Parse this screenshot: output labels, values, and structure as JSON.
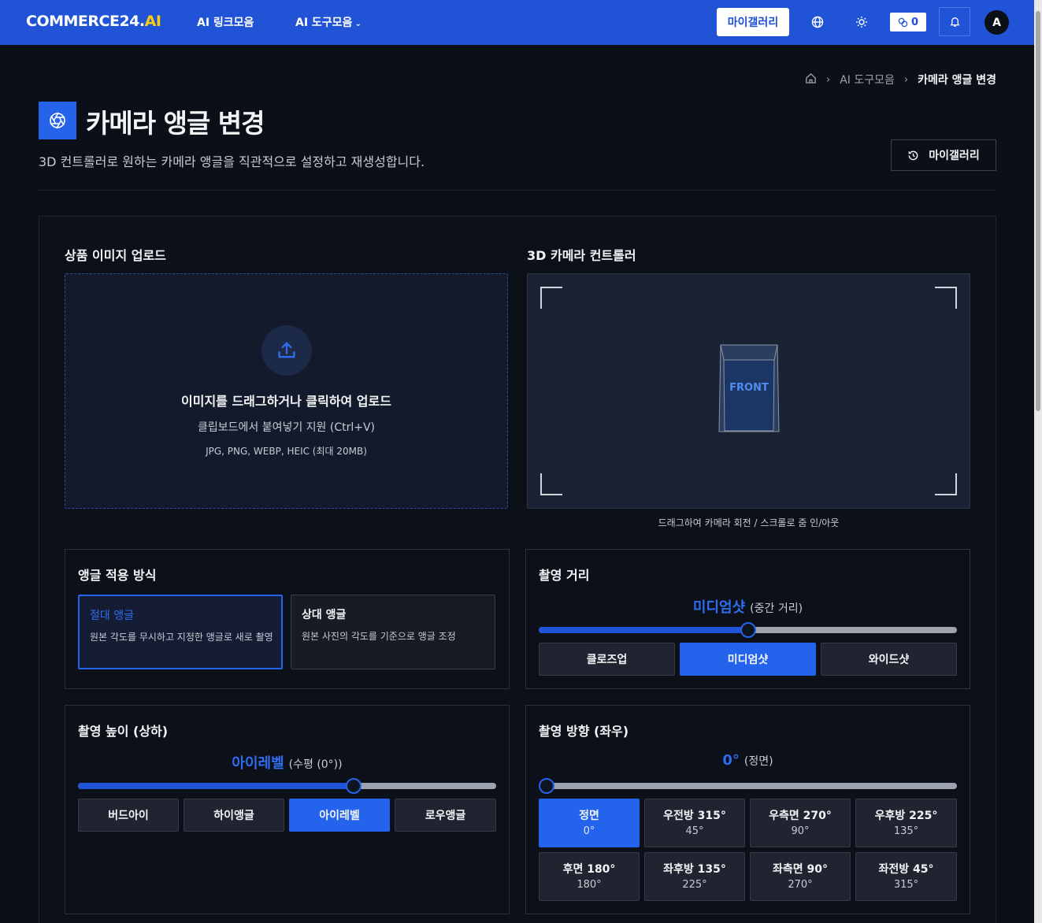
{
  "nav": {
    "logo_main": "COMMERCE24.",
    "logo_ai": "AI",
    "links": [
      "AI 링크모음",
      "AI 도구모음"
    ],
    "gallery_button": "마이갤러리",
    "credits": "0",
    "avatar_letter": "A"
  },
  "breadcrumb": [
    "AI 도구모음",
    "카메라 앵글 변경"
  ],
  "page": {
    "title": "카메라 앵글 변경",
    "subtitle": "3D 컨트롤러로 원하는 카메라 앵글을 직관적으로 설정하고 재생성합니다.",
    "gallery_button": "마이갤러리"
  },
  "upload": {
    "section_label": "상품 이미지 업로드",
    "title": "이미지를 드래그하거나 클릭하여 업로드",
    "sub1": "클립보드에서 붙여넣기 지원 (Ctrl+V)",
    "sub2": "JPG, PNG, WEBP, HEIC (최대 20MB)"
  },
  "controller": {
    "section_label": "3D 카메라 컨트롤러",
    "front_label": "FRONT",
    "hint": "드래그하여 카메라 회전 / 스크롤로 줌 인/아웃"
  },
  "angle_mode": {
    "title": "앵글 적용 방식",
    "options": [
      {
        "title": "절대 앵글",
        "desc": "원본 각도를 무시하고 지정한 앵글로 새로 촬영",
        "active": true
      },
      {
        "title": "상대 앵글",
        "desc": "원본 사진의 각도를 기준으로 앵글 조정",
        "active": false
      }
    ]
  },
  "distance": {
    "title": "촬영 거리",
    "value_label": "미디엄샷",
    "value_note": "(중간 거리)",
    "slider_fraction": 0.5,
    "options": [
      "클로즈업",
      "미디엄샷",
      "와이드샷"
    ],
    "active_index": 1
  },
  "height": {
    "title": "촬영 높이 (상하)",
    "value_label": "아이레벨",
    "value_note": "(수평 (0°))",
    "slider_fraction": 0.66,
    "options": [
      "버드아이",
      "하이앵글",
      "아이레벨",
      "로우앵글"
    ],
    "active_index": 2
  },
  "direction": {
    "title": "촬영 방향 (좌우)",
    "value_label": "0°",
    "value_note": "(정면)",
    "slider_fraction": 0,
    "options": [
      {
        "name": "정면",
        "deg": "0°"
      },
      {
        "name": "우전방 315°",
        "deg": "45°"
      },
      {
        "name": "우측면 270°",
        "deg": "90°"
      },
      {
        "name": "우후방 225°",
        "deg": "135°"
      },
      {
        "name": "후면 180°",
        "deg": "180°"
      },
      {
        "name": "좌후방 135°",
        "deg": "225°"
      },
      {
        "name": "좌측면 90°",
        "deg": "270°"
      },
      {
        "name": "좌전방 45°",
        "deg": "315°"
      }
    ],
    "active_index": 0
  },
  "colors": {
    "nav_bg": "#2153d6",
    "accent": "#2563eb",
    "page_bg": "#0b0f17"
  }
}
